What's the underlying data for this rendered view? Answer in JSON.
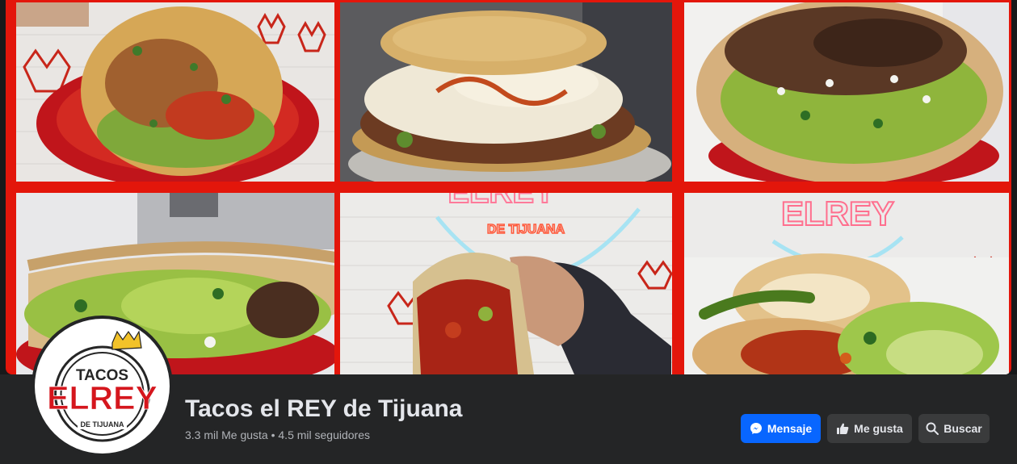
{
  "page": {
    "name": "Tacos el REY de Tijuana",
    "stats": "3.3 mil Me gusta • 4.5 mil seguidores"
  },
  "logo": {
    "line1": "TACOS",
    "line2": "ELREY",
    "line3": "DE TIJUANA"
  },
  "cover": {
    "neon_sign_line1": "ELREY",
    "neon_sign_line2": "DE TIJUANA",
    "tile_count": 6
  },
  "actions": {
    "message_label": "Mensaje",
    "like_label": "Me gusta",
    "search_label": "Buscar"
  },
  "colors": {
    "brand_red": "#e3160b",
    "primary_button": "#0866ff",
    "secondary_button": "#3a3b3c",
    "background": "#242526"
  },
  "icons": {
    "message": "messenger-icon",
    "like": "thumbs-up-icon",
    "search": "search-icon"
  }
}
